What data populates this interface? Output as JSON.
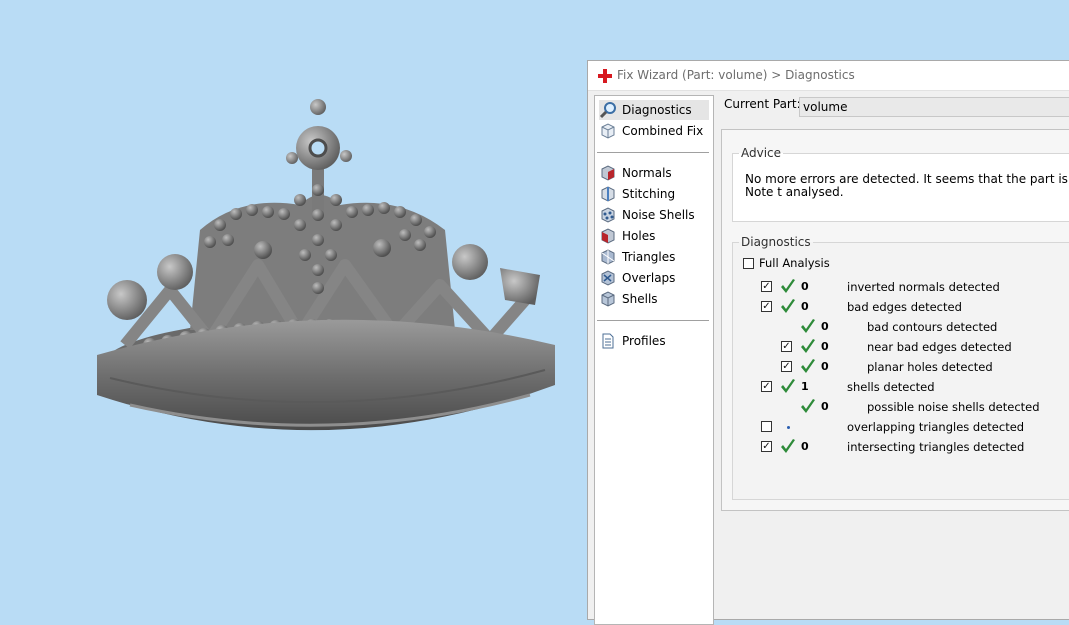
{
  "dialog": {
    "title": "Fix Wizard (Part: volume) > Diagnostics",
    "accent_color": "#d71920"
  },
  "sidebar": {
    "items": [
      {
        "label": "Diagnostics",
        "icon": "magnifier-icon",
        "selected": true
      },
      {
        "label": "Combined Fix",
        "icon": "cube-icon"
      },
      {
        "label": "Normals",
        "icon": "normals-cube-icon"
      },
      {
        "label": "Stitching",
        "icon": "stitching-cube-icon"
      },
      {
        "label": "Noise Shells",
        "icon": "noise-shells-cube-icon"
      },
      {
        "label": "Holes",
        "icon": "holes-cube-icon"
      },
      {
        "label": "Triangles",
        "icon": "triangles-cube-icon"
      },
      {
        "label": "Overlaps",
        "icon": "overlaps-cube-icon"
      },
      {
        "label": "Shells",
        "icon": "shells-cube-icon"
      },
      {
        "label": "Profiles",
        "icon": "document-icon"
      }
    ]
  },
  "current_part": {
    "label": "Current Part:",
    "value": "volume"
  },
  "advice": {
    "legend": "Advice",
    "text": "No more errors are detected. It seems that the part is ok. Note t analysed."
  },
  "diagnostics": {
    "legend": "Diagnostics",
    "full_analysis_label": "Full Analysis",
    "full_analysis_checked": false,
    "rows": [
      {
        "checked": true,
        "status": "ok",
        "count": "0",
        "label": "inverted normals detected",
        "level": 0
      },
      {
        "checked": true,
        "status": "ok",
        "count": "0",
        "label": "bad edges detected",
        "level": 0
      },
      {
        "checked": null,
        "status": "ok",
        "count": "0",
        "label": "bad contours detected",
        "level": 1
      },
      {
        "checked": true,
        "status": "ok",
        "count": "0",
        "label": "near bad edges detected",
        "level": 1
      },
      {
        "checked": true,
        "status": "ok",
        "count": "0",
        "label": "planar holes detected",
        "level": 1
      },
      {
        "checked": true,
        "status": "ok",
        "count": "1",
        "label": "shells detected",
        "level": 0
      },
      {
        "checked": null,
        "status": "ok",
        "count": "0",
        "label": "possible noise shells detected",
        "level": 1
      },
      {
        "checked": false,
        "status": "pending",
        "count": "",
        "label": "overlapping triangles detected",
        "level": 0
      },
      {
        "checked": true,
        "status": "ok",
        "count": "0",
        "label": "intersecting triangles detected",
        "level": 0
      }
    ]
  },
  "colors": {
    "viewport_bg": "#b9dcf5",
    "model": "#8a8a8a",
    "check_ok": "#2e8b3a"
  }
}
